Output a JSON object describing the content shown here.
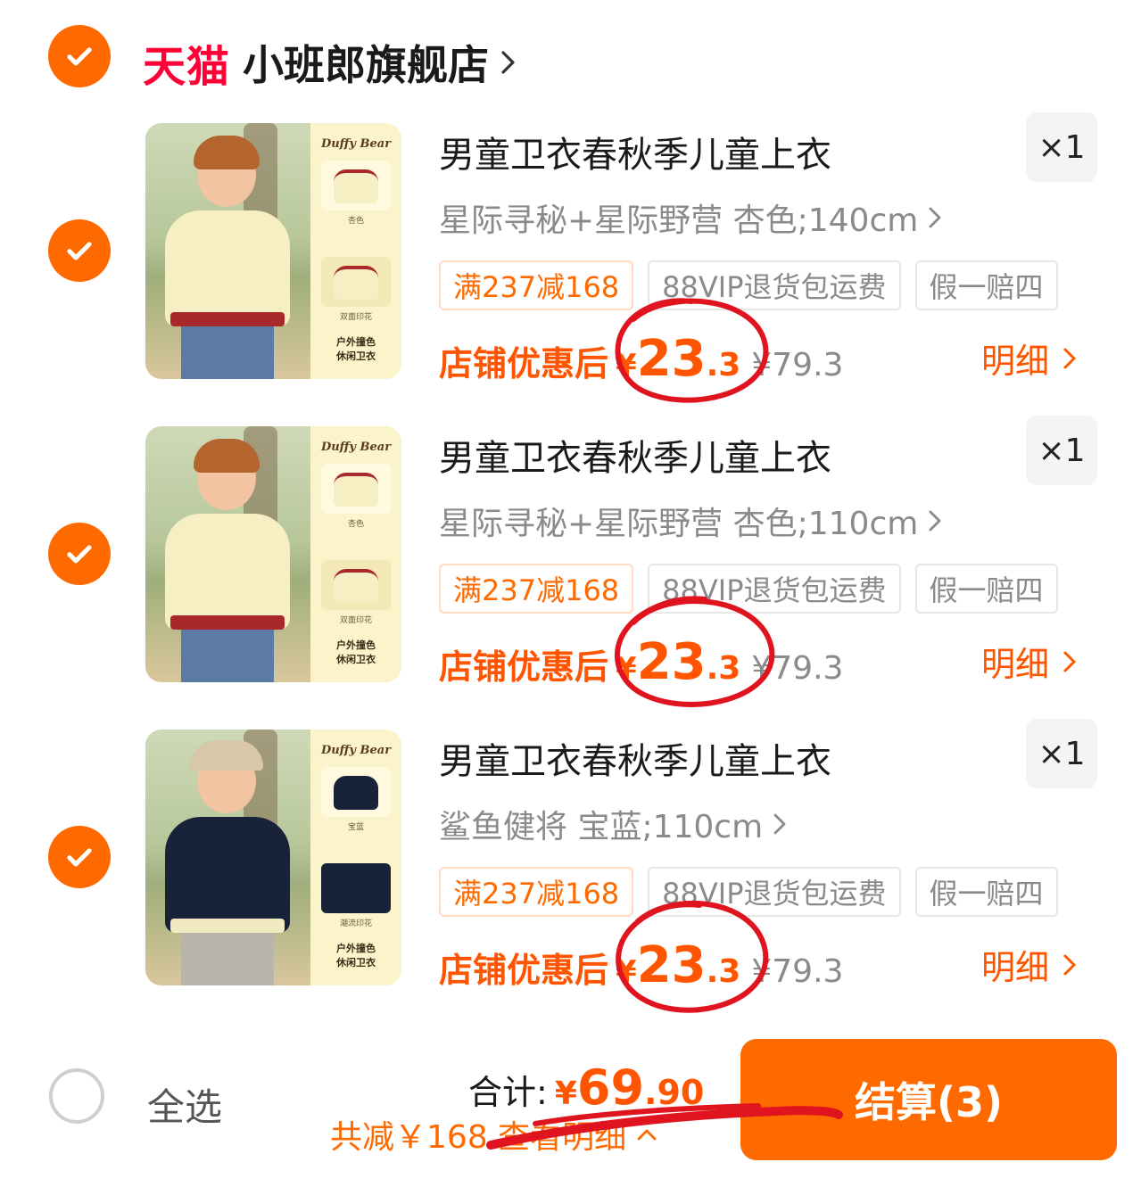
{
  "store": {
    "platform": "天猫",
    "name": "小班郎旗舰店"
  },
  "items": [
    {
      "brand": "Duffy Bear",
      "title": "男童卫衣春秋季儿童上衣",
      "qty": "×1",
      "sku": "星际寻秘+星际野营 杏色;140cm",
      "tags": [
        "满237减168",
        "88VIP退货包运费",
        "假一赔四"
      ],
      "price_label": "店铺优惠后",
      "price_currency": "¥",
      "price_int": "23",
      "price_dec": ".3",
      "orig_price": "¥79.3",
      "detail": "明细",
      "swatch_labels": [
        "杏色",
        "双面印花"
      ],
      "panel_caption": [
        "户外撞色",
        "休闲卫衣"
      ]
    },
    {
      "brand": "Duffy Bear",
      "title": "男童卫衣春秋季儿童上衣",
      "qty": "×1",
      "sku": "星际寻秘+星际野营 杏色;110cm",
      "tags": [
        "满237减168",
        "88VIP退货包运费",
        "假一赔四"
      ],
      "price_label": "店铺优惠后",
      "price_currency": "¥",
      "price_int": "23",
      "price_dec": ".3",
      "orig_price": "¥79.3",
      "detail": "明细",
      "swatch_labels": [
        "杏色",
        "双面印花"
      ],
      "panel_caption": [
        "户外撞色",
        "休闲卫衣"
      ]
    },
    {
      "brand": "Duffy Bear",
      "title": "男童卫衣春秋季儿童上衣",
      "qty": "×1",
      "sku": "鲨鱼健将 宝蓝;110cm",
      "tags": [
        "满237减168",
        "88VIP退货包运费",
        "假一赔四"
      ],
      "price_label": "店铺优惠后",
      "price_currency": "¥",
      "price_int": "23",
      "price_dec": ".3",
      "orig_price": "¥79.3",
      "detail": "明细",
      "swatch_labels": [
        "宝蓝",
        "潮流印花"
      ],
      "panel_caption": [
        "户外撞色",
        "休闲卫衣"
      ]
    }
  ],
  "footer": {
    "select_all": "全选",
    "total_label": "合计:",
    "total_currency": "¥",
    "total_int": "69",
    "total_dec": ".90",
    "savings": "共减￥168 查看明细",
    "checkout": "结算(3)"
  },
  "colors": {
    "accent": "#ff6a00",
    "price": "#ff5500",
    "tmall": "#ff0036",
    "annotation": "#e0141e"
  }
}
